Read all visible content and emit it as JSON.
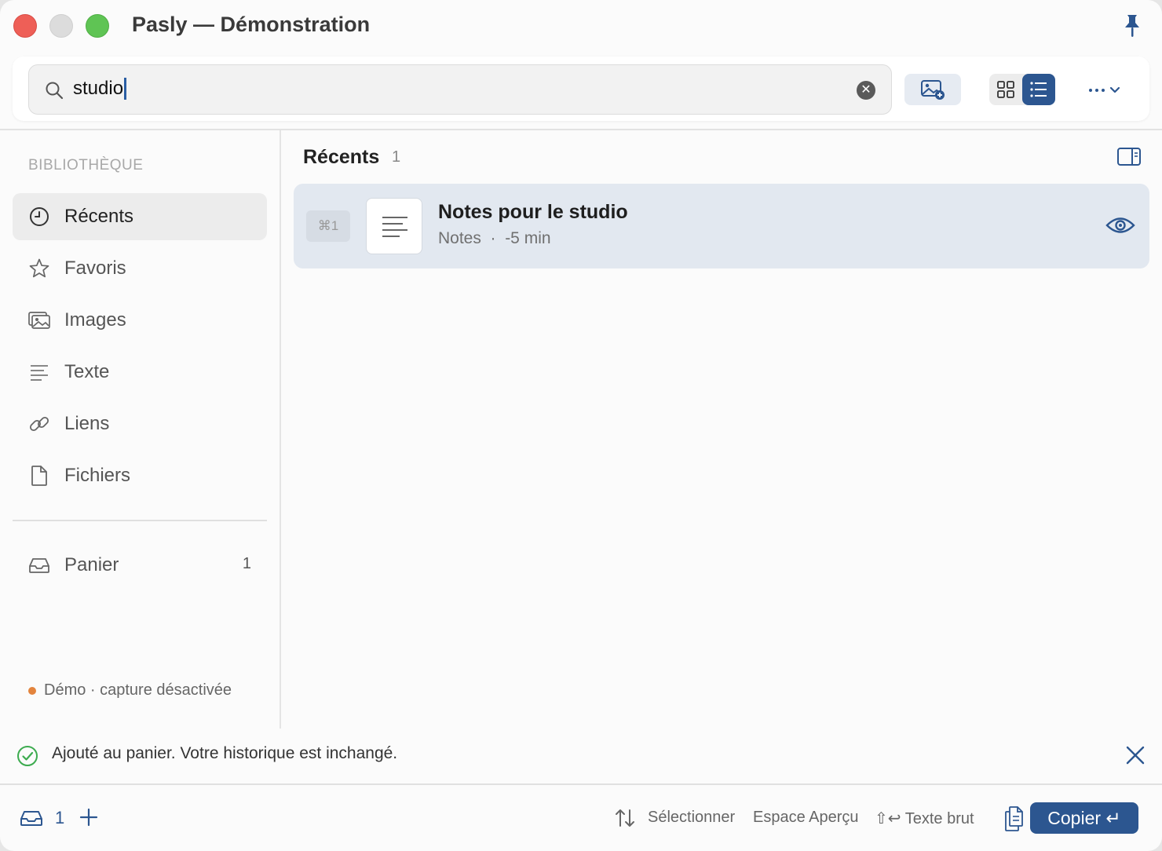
{
  "window": {
    "title": "Pasly — Démonstration",
    "accent": "#2c5690"
  },
  "search": {
    "value": "studio",
    "clear_icon": "clear-circle-icon"
  },
  "sidebar": {
    "section_title": "BIBLIOTHÈQUE",
    "items": [
      {
        "label": "Récents",
        "icon": "clock-icon",
        "active": true
      },
      {
        "label": "Favoris",
        "icon": "star-icon"
      },
      {
        "label": "Images",
        "icon": "images-icon"
      },
      {
        "label": "Texte",
        "icon": "text-lines-icon"
      },
      {
        "label": "Liens",
        "icon": "link-icon"
      },
      {
        "label": "Fichiers",
        "icon": "file-icon"
      }
    ],
    "tray": {
      "label": "Panier",
      "count": "1",
      "icon": "tray-icon"
    },
    "status": "Démo · capture désactivée",
    "status_color": "#e3843d"
  },
  "main": {
    "title": "Récents",
    "count": "1",
    "rows": [
      {
        "shortcut": "⌘1",
        "title": "Notes pour le studio",
        "meta": "Notes  ·  -5 min",
        "thumb_icon": "text-lines-icon",
        "action_icon": "eye-icon"
      }
    ]
  },
  "toast": {
    "message": "Ajouté au panier. Votre historique est inchangé.",
    "icon": "check-circle-icon",
    "color": "#3cab4f"
  },
  "footer": {
    "tray_count": "1",
    "hints": {
      "select": "Sélectionner",
      "space": "Espace Aperçu",
      "raw": "⇧↩ Texte brut"
    },
    "copy_label": "Copier ↵"
  }
}
